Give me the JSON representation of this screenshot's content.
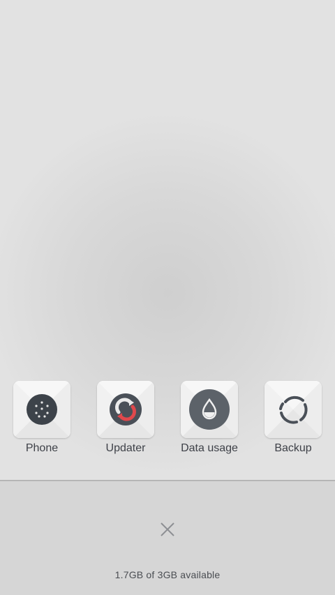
{
  "recents": {
    "apps": [
      {
        "label": "Phone",
        "icon": "phone-dialpad-icon"
      },
      {
        "label": "Updater",
        "icon": "updater-icon"
      },
      {
        "label": "Data usage",
        "icon": "data-usage-drop-icon"
      },
      {
        "label": "Backup",
        "icon": "backup-ring-icon"
      }
    ],
    "close_icon": "close-icon",
    "storage_text": "1.7GB of 3GB available"
  },
  "colors": {
    "icon_dark": "#3d434a",
    "updater_accent": "#e0484c",
    "tile_bg": "#f4f4f4"
  }
}
